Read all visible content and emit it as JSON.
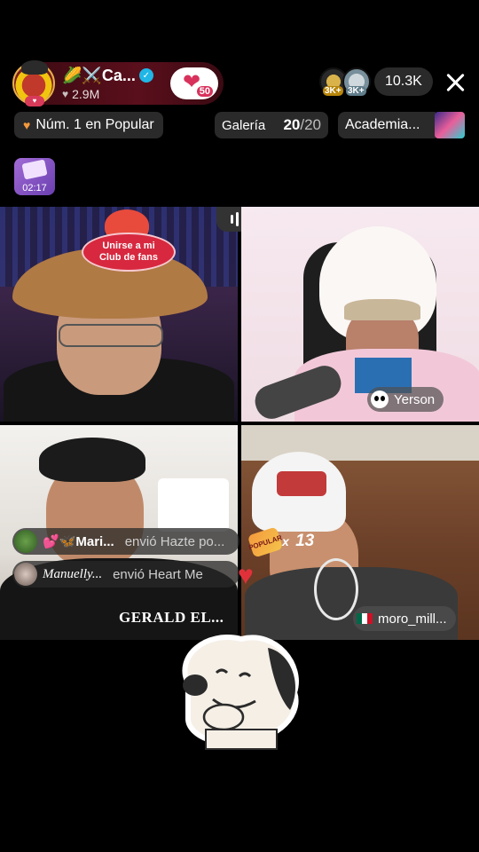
{
  "host": {
    "name": "🌽⚔️Ca...",
    "likes": "2.9M",
    "fan_level": "50",
    "colors": {
      "pill": "#5a0f1c",
      "accent": "#d8325c",
      "verified": "#20b6e6"
    }
  },
  "viewers": {
    "top_badges": [
      "3K+",
      "3K+"
    ],
    "count": "10.3K"
  },
  "rank": {
    "label": "Núm. 1 en Popular"
  },
  "gallery": {
    "label": "Galería",
    "current": "20",
    "total": "/20"
  },
  "academy": {
    "label": "Academia..."
  },
  "gift_timer": {
    "time": "02:17"
  },
  "tiles": {
    "top_left": {
      "club_badge": "Unirse a mi Club de fans"
    },
    "top_right": {
      "name": "Yerson"
    },
    "bottom_left": {
      "name": "GERALD EL..."
    },
    "bottom_right": {
      "name": "moro_mill..."
    }
  },
  "chat": [
    {
      "name": "💕🦋Mari...",
      "message": "envió Hazte po..."
    },
    {
      "name": "Manuelly...",
      "message": "envió Heart Me"
    }
  ],
  "gift_combo": {
    "badge": "POPULAR",
    "multiplier": "x",
    "count": "13"
  }
}
